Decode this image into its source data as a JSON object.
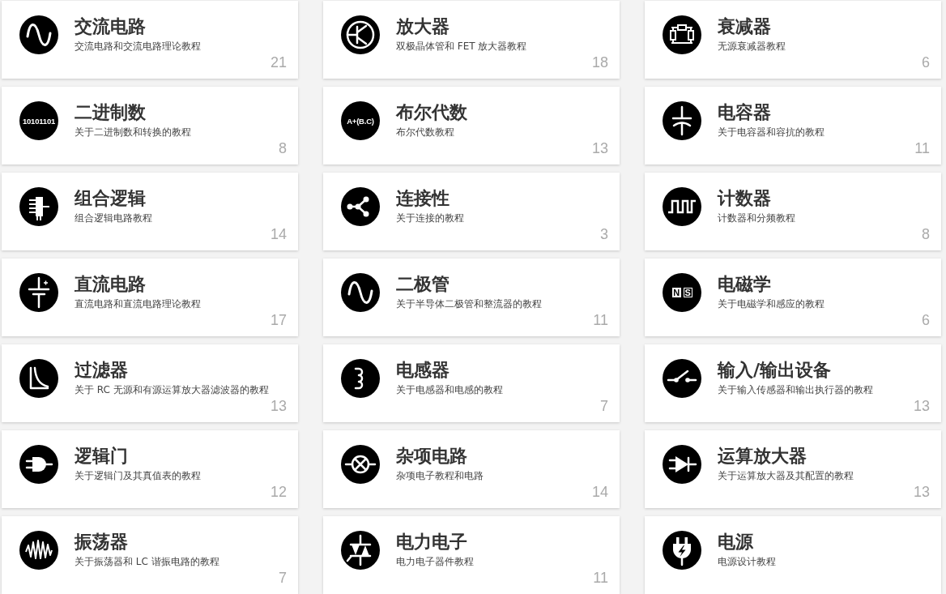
{
  "cards": [
    {
      "kind": "drawing",
      "title": "交流电路",
      "description": "交流电路和交流电路理论教程",
      "count": "21"
    },
    {
      "kind": "drawing",
      "title": "放大器",
      "description": "双极晶体管和 FET 放大器教程",
      "count": "18"
    },
    {
      "kind": "drawing",
      "title": "衰减器",
      "description": "无源衰减器教程",
      "count": "6"
    },
    {
      "kind": "text",
      "icon_text": [
        "10101101"
      ],
      "title": "二进制数",
      "description": "关于二进制数和转换的教程",
      "count": "8"
    },
    {
      "kind": "text",
      "icon_text": [
        "A+(B.C)"
      ],
      "title": "布尔代数",
      "description": "布尔代数教程",
      "count": "13"
    },
    {
      "kind": "drawing",
      "title": "电容器",
      "description": "关于电容器和容抗的教程",
      "count": "11"
    },
    {
      "kind": "drawing",
      "title": "组合逻辑",
      "description": "组合逻辑电路教程",
      "count": "14"
    },
    {
      "kind": "drawing",
      "title": "连接性",
      "description": "关于连接的教程",
      "count": "3"
    },
    {
      "kind": "drawing",
      "title": "计数器",
      "description": "计数器和分频教程",
      "count": "8"
    },
    {
      "kind": "drawing",
      "title": "直流电路",
      "description": "直流电路和直流电路理论教程",
      "count": "17"
    },
    {
      "kind": "drawing",
      "title": "二极管",
      "description": "关于半导体二极管和整流器的教程",
      "count": "11"
    },
    {
      "kind": "magnet",
      "icon_text": [
        "N",
        "S"
      ],
      "title": "电磁学",
      "description": "关于电磁学和感应的教程",
      "count": "6"
    },
    {
      "kind": "drawing",
      "title": "过滤器",
      "description": "关于 RC 无源和有源运算放大器滤波器的教程",
      "count": "13"
    },
    {
      "kind": "drawing",
      "title": "电感器",
      "description": "关于电感器和电感的教程",
      "count": "7"
    },
    {
      "kind": "drawing",
      "title": "输入/输出设备",
      "description": "关于输入传感器和输出执行器的教程",
      "count": "13"
    },
    {
      "kind": "drawing",
      "title": "逻辑门",
      "description": "关于逻辑门及其真值表的教程",
      "count": "12"
    },
    {
      "kind": "drawing",
      "title": "杂项电路",
      "description": "杂项电子教程和电路",
      "count": "14"
    },
    {
      "kind": "drawing",
      "title": "运算放大器",
      "description": "关于运算放大器及其配置的教程",
      "count": "13"
    },
    {
      "kind": "drawing",
      "title": "振荡器",
      "description": "关于振荡器和 LC 谐振电路的教程",
      "count": "7"
    },
    {
      "kind": "drawing",
      "title": "电力电子",
      "description": "电力电子器件教程",
      "count": "11"
    },
    {
      "kind": "drawing",
      "title": "电源",
      "description": "电源设计教程"
    }
  ]
}
